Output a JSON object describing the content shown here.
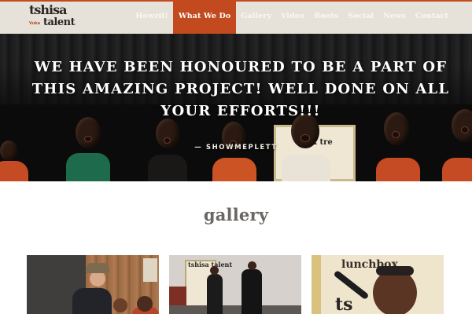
{
  "header": {
    "logo": {
      "line1": "tshisa",
      "line2": "talent",
      "tag": "Vuka"
    },
    "nav": [
      {
        "label": "Howzit!",
        "active": false
      },
      {
        "label": "What We Do",
        "active": true
      },
      {
        "label": "Gallery",
        "active": false
      },
      {
        "label": "Video",
        "active": false
      },
      {
        "label": "Roots",
        "active": false
      },
      {
        "label": "Social",
        "active": false
      },
      {
        "label": "News",
        "active": false
      },
      {
        "label": "Contact",
        "active": false
      }
    ]
  },
  "hero": {
    "quote": "We have been honoured to be a part of this amazing project! Well done on all your efforts!!!",
    "author": "— SHOWMEPLETT",
    "banner_text": "x tre"
  },
  "gallery": {
    "title": "gallery",
    "thumb2_logo": "tshisa talent",
    "thumb3_top": "lunchbox",
    "thumb3_bottom": "ts"
  },
  "colors": {
    "accent": "#c24a1e",
    "header_bg": "#e7e2d9",
    "title_gray": "#6b6764"
  }
}
